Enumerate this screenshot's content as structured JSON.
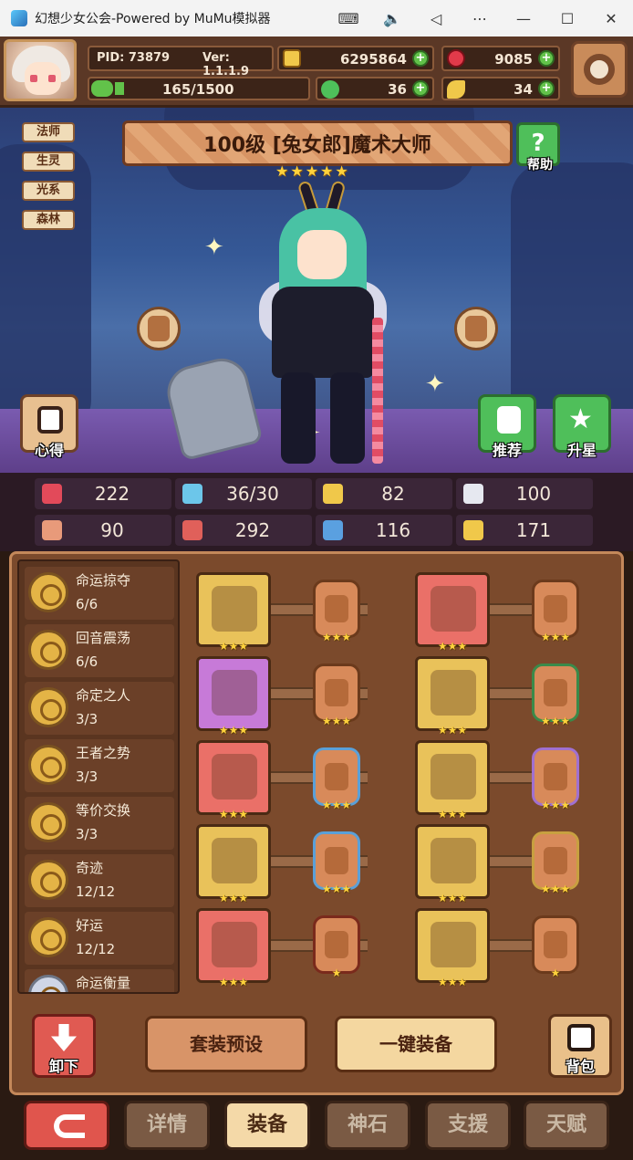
{
  "window": {
    "title": "幻想少女公会-Powered by MuMu模拟器",
    "controls": [
      "keyboard-icon",
      "volume-icon",
      "back-icon",
      "more-icon",
      "minimize-icon",
      "maximize-icon",
      "close-icon"
    ]
  },
  "resources": {
    "pid": "PID: 73879",
    "version": "Ver: 1.1.1.9",
    "gold": "6295864",
    "gems": "9085",
    "stamina": "165/1500",
    "clover": "36",
    "feather": "34"
  },
  "character": {
    "tags": [
      "法师",
      "生灵",
      "光系",
      "森林"
    ],
    "title": "100级 [兔女郎]魔术大师",
    "star_count": 5,
    "help_label": "帮助",
    "notes_label": "心得",
    "recommend_label": "推荐",
    "star_up_label": "升星"
  },
  "stats": [
    {
      "icon": "heart-icon",
      "value": "222",
      "color": "#e24a5a"
    },
    {
      "icon": "water-drop-icon",
      "value": "36/30",
      "color": "#6cc6ea"
    },
    {
      "icon": "shield-icon",
      "value": "82",
      "color": "#f0c84a"
    },
    {
      "icon": "wing-icon",
      "value": "100",
      "color": "#e6e8f0"
    },
    {
      "icon": "fist-icon",
      "value": "90",
      "color": "#e89a7a"
    },
    {
      "icon": "book-icon",
      "value": "292",
      "color": "#e0605a"
    },
    {
      "icon": "boot-icon",
      "value": "116",
      "color": "#5aa0e0"
    },
    {
      "icon": "horseshoe-icon",
      "value": "171",
      "color": "#f0c84a"
    }
  ],
  "sets": [
    {
      "name": "命运掠夺",
      "progress": "6/6"
    },
    {
      "name": "回音震荡",
      "progress": "6/6"
    },
    {
      "name": "命定之人",
      "progress": "3/3"
    },
    {
      "name": "王者之势",
      "progress": "3/3"
    },
    {
      "name": "等价交换",
      "progress": "3/3"
    },
    {
      "name": "奇迹",
      "progress": "12/12"
    },
    {
      "name": "好运",
      "progress": "12/12"
    },
    {
      "name": "命运衡量",
      "progress": ""
    }
  ],
  "equipment": [
    {
      "item": "axe-icon",
      "item_bg": "#e9c25a",
      "rune_border": "#6b3a1c",
      "item_stars": 3,
      "rune_stars": 3
    },
    {
      "item": "straw-hat-icon",
      "item_bg": "#ea7068",
      "rune_border": "#6b3a1c",
      "item_stars": 3,
      "rune_stars": 3
    },
    {
      "item": "crystal-orb-icon",
      "item_bg": "#c77ad8",
      "rune_border": "#6b3a1c",
      "item_stars": 3,
      "rune_stars": 3
    },
    {
      "item": "armor-icon",
      "item_bg": "#e9c25a",
      "rune_border": "#3a8a4a",
      "item_stars": 3,
      "rune_stars": 3
    },
    {
      "item": "necklace-icon",
      "item_bg": "#ea7068",
      "rune_border": "#5aa0d8",
      "item_stars": 3,
      "rune_stars": 3
    },
    {
      "item": "bone-wand-icon",
      "item_bg": "#e9c25a",
      "rune_border": "#a070d0",
      "item_stars": 3,
      "rune_stars": 3
    },
    {
      "item": "scroll-icon",
      "item_bg": "#e9c25a",
      "rune_border": "#5aa0d8",
      "item_stars": 3,
      "rune_stars": 3
    },
    {
      "item": "fur-collar-icon",
      "item_bg": "#e9c25a",
      "rune_border": "#c8a040",
      "item_stars": 3,
      "rune_stars": 3
    },
    {
      "item": "treasure-pot-icon",
      "item_bg": "#ea7068",
      "rune_border": "#7a2a1c",
      "item_stars": 3,
      "rune_stars": 1
    },
    {
      "item": "boots-icon",
      "item_bg": "#e9c25a",
      "rune_border": "#6b3a1c",
      "item_stars": 3,
      "rune_stars": 1
    }
  ],
  "actions": {
    "unload": "卸下",
    "preset": "套装预设",
    "equip_all": "一键装备",
    "bag": "背包"
  },
  "nav": {
    "tabs": [
      "详情",
      "装备",
      "神石",
      "支援",
      "天赋"
    ],
    "active": 1
  }
}
